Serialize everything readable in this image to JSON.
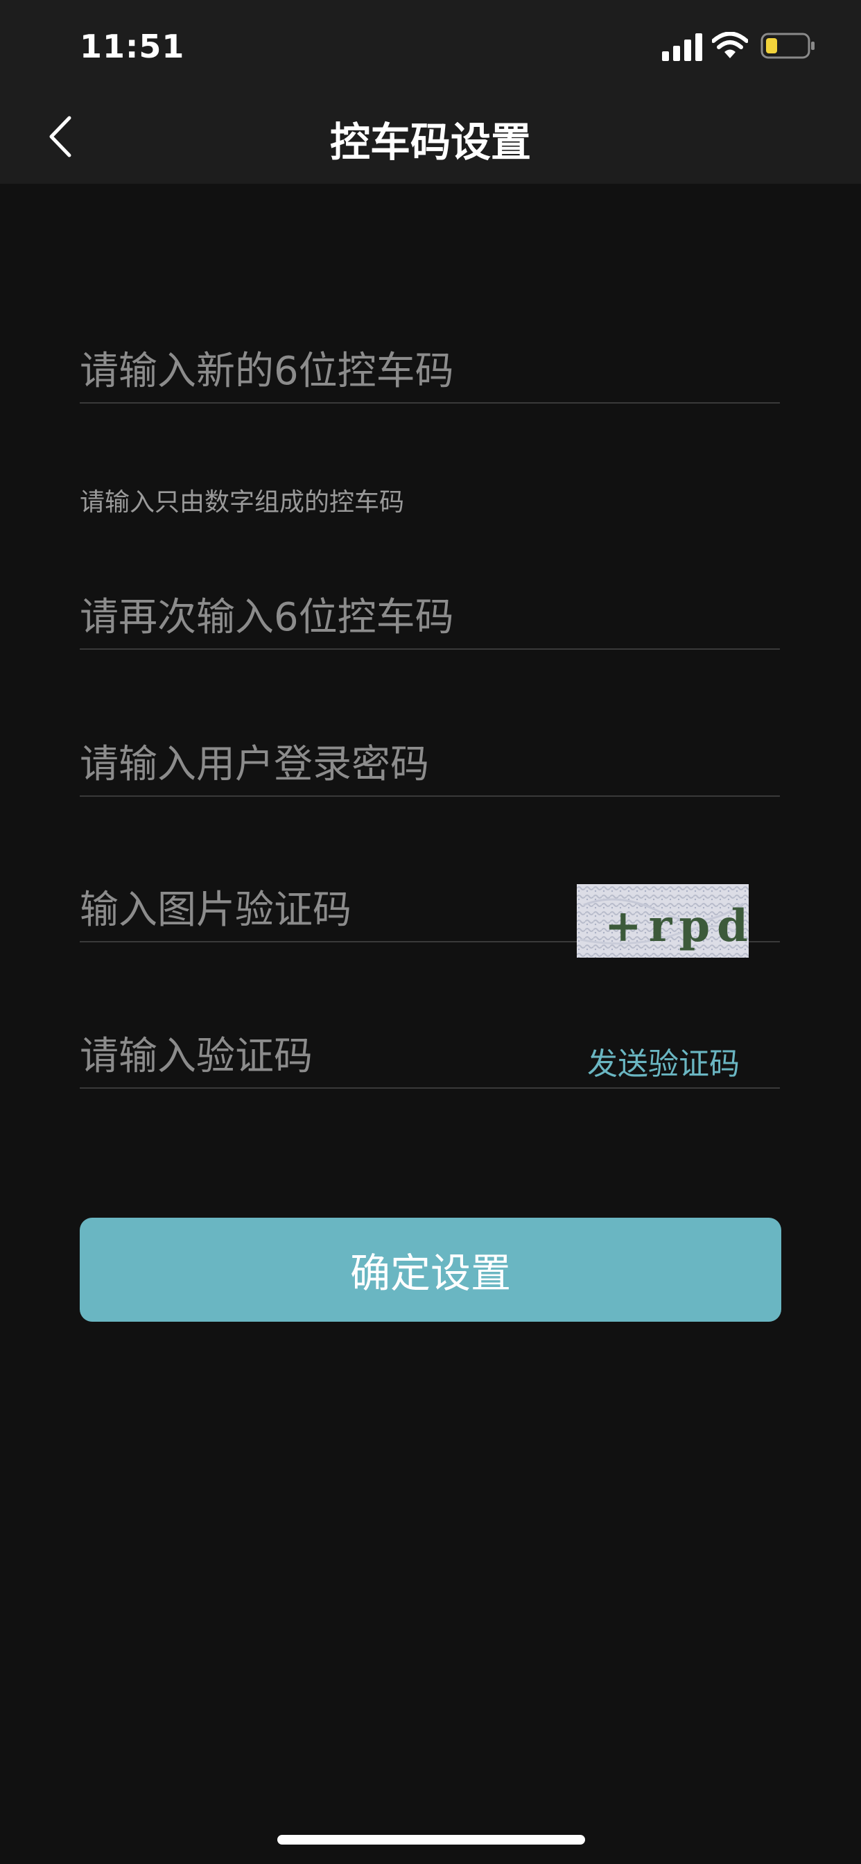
{
  "status_bar": {
    "time": "11:51"
  },
  "header": {
    "title": "控车码设置"
  },
  "form": {
    "new_code_placeholder": "请输入新的6位控车码",
    "hint": "请输入只由数字组成的控车码",
    "confirm_code_placeholder": "请再次输入6位控车码",
    "password_placeholder": "请输入用户登录密码",
    "captcha_placeholder": "输入图片验证码",
    "captcha_text": "+rpd",
    "sms_code_placeholder": "请输入验证码",
    "send_code_label": "发送验证码",
    "confirm_label": "确定设置"
  },
  "colors": {
    "accent": "#6ab6c2",
    "background": "#111111",
    "header_bg": "#1d1d1d"
  }
}
